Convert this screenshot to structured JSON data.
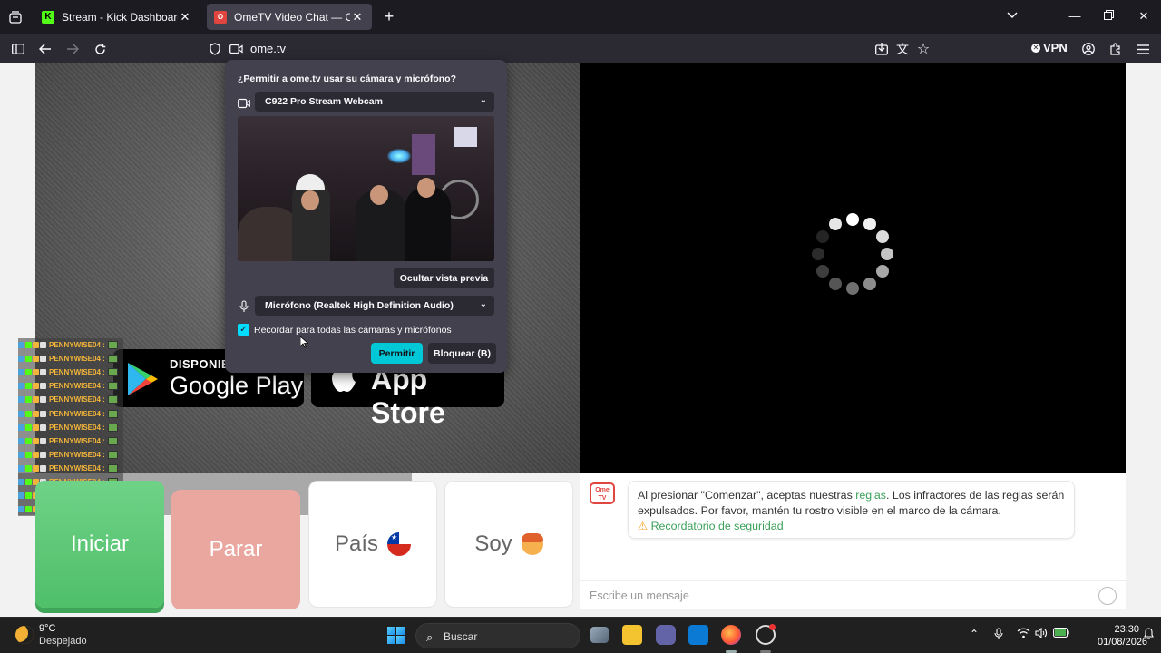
{
  "browser": {
    "tabs": [
      {
        "title": "Stream - Kick Dashboard",
        "favicon": "K",
        "active": false
      },
      {
        "title": "OmeTV Video Chat — Omegle I",
        "favicon": "O",
        "active": true
      }
    ],
    "url": "ome.tv",
    "vpn_label": "VPN"
  },
  "permission": {
    "question": "¿Permitir a ome.tv usar su cámara y micrófono?",
    "camera": "C922 Pro Stream Webcam",
    "hide_preview": "Ocultar vista previa",
    "microphone": "Micrófono (Realtek High Definition Audio)",
    "remember": "Recordar para todas las cámaras y micrófonos",
    "allow": "Permitir",
    "block": "Bloquear (B)"
  },
  "store_badges": {
    "google_small": "DISPONIB",
    "google_big": "Google Play",
    "apple_big": "App Store"
  },
  "overlay_chat": {
    "user": "PENNYWISE04 :",
    "rows": 13
  },
  "controls": {
    "start": "Iniciar",
    "stop": "Parar",
    "country": "País",
    "gender": "Soy"
  },
  "chat": {
    "logo": "Ome TV",
    "notice_pre": "Al presionar \"Comenzar\", aceptas nuestras ",
    "notice_link": "reglas",
    "notice_post": ". Los infractores de las reglas serán expulsados. Por favor, mantén tu rostro visible en el marco de la cámara.",
    "security_reminder": "Recordatorio de seguridad",
    "input_placeholder": "Escribe un mensaje"
  },
  "taskbar": {
    "temperature": "9°C",
    "weather": "Despejado",
    "search": "Buscar",
    "time": "23:30",
    "date": "01/08/2026"
  },
  "colors": {
    "start_green": "#4fbf6a",
    "stop_red": "#e9a7a0",
    "accent_cyan": "#00c8d7",
    "link_green": "#3ba15a"
  }
}
